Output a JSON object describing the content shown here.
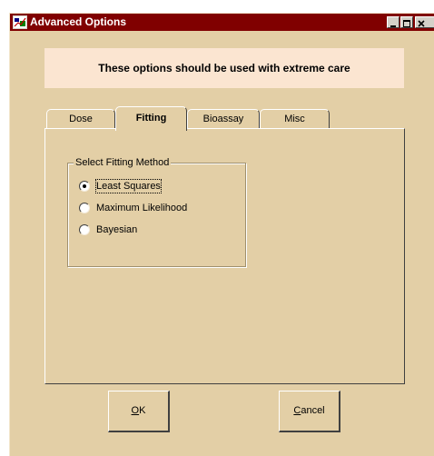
{
  "window": {
    "title": "Advanced Options",
    "title_bar_color": "#800000",
    "background_color": "#e3cfa6"
  },
  "title_buttons": [
    {
      "name": "minimize-button",
      "icon": "minimize-icon"
    },
    {
      "name": "maximize-button",
      "icon": "maximize-icon"
    },
    {
      "name": "close-button",
      "icon": "close-icon"
    }
  ],
  "banner": {
    "text": "These options should be used with extreme care",
    "background_color": "#fbe5d1"
  },
  "tabs": [
    {
      "label": "Dose",
      "active": false
    },
    {
      "label": "Fitting",
      "active": true
    },
    {
      "label": "Bioassay",
      "active": false
    },
    {
      "label": "Misc",
      "active": false
    }
  ],
  "fitting": {
    "group_label": "Select Fitting Method",
    "options": [
      {
        "label": "Least Squares",
        "selected": true,
        "focused": true
      },
      {
        "label": "Maximum Likelihood",
        "selected": false,
        "focused": false
      },
      {
        "label": "Bayesian",
        "selected": false,
        "focused": false
      }
    ]
  },
  "buttons": {
    "ok": {
      "mnemonic": "O",
      "rest": "K"
    },
    "cancel": {
      "mnemonic": "C",
      "rest": "ancel"
    }
  }
}
